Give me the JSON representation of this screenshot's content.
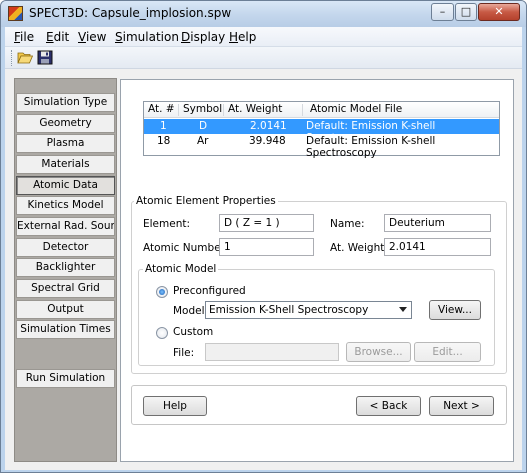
{
  "window": {
    "title": "SPECT3D:  Capsule_implosion.spw",
    "controls": {
      "minimize": "–",
      "maximize": "□",
      "close": "✕"
    }
  },
  "menu": {
    "items": [
      "File",
      "Edit",
      "View",
      "Simulation",
      "Display",
      "Help"
    ]
  },
  "toolbar": {
    "icons": [
      "open-folder-icon",
      "save-icon"
    ]
  },
  "nav": {
    "items": [
      "Simulation Type",
      "Geometry",
      "Plasma",
      "Materials",
      "Atomic Data",
      "Kinetics Model",
      "External Rad. Source",
      "Detector",
      "Backlighter",
      "Spectral Grid",
      "Output",
      "Simulation Times"
    ],
    "selected": "Atomic Data",
    "run_button": "Run Simulation"
  },
  "table": {
    "columns": [
      "At. #",
      "Symbol",
      "At. Weight",
      "Atomic Model File"
    ],
    "rows": [
      {
        "atomic_number": "1",
        "symbol": "D",
        "weight": "2.0141",
        "model_file": "Default:  Emission K-shell Spectroscopy",
        "selected": true
      },
      {
        "atomic_number": "18",
        "symbol": "Ar",
        "weight": "39.948",
        "model_file": "Default:  Emission K-shell Spectroscopy",
        "selected": false
      }
    ]
  },
  "properties": {
    "group_title": "Atomic Element Properties",
    "element_label": "Element:",
    "element_value": "D  ( Z = 1 )",
    "name_label": "Name:",
    "name_value": "Deuterium",
    "atomic_number_label": "Atomic Number:",
    "atomic_number_value": "1",
    "weight_label": "At. Weight:",
    "weight_value": "2.0141"
  },
  "atomic_model": {
    "group_title": "Atomic Model",
    "preconfigured_label": "Preconfigured",
    "preconfigured_selected": true,
    "model_label": "Model:",
    "model_value": "Emission K-Shell Spectroscopy",
    "view_button": "View...",
    "custom_label": "Custom",
    "file_label": "File:",
    "file_value": "",
    "browse_button": "Browse...",
    "edit_button": "Edit..."
  },
  "footer": {
    "help_button": "Help",
    "back_button": "< Back",
    "next_button": "Next >"
  },
  "colors": {
    "selection": "#3399ff",
    "nav_panel": "#aca9a4",
    "title_bar": "#c3d6ec"
  }
}
